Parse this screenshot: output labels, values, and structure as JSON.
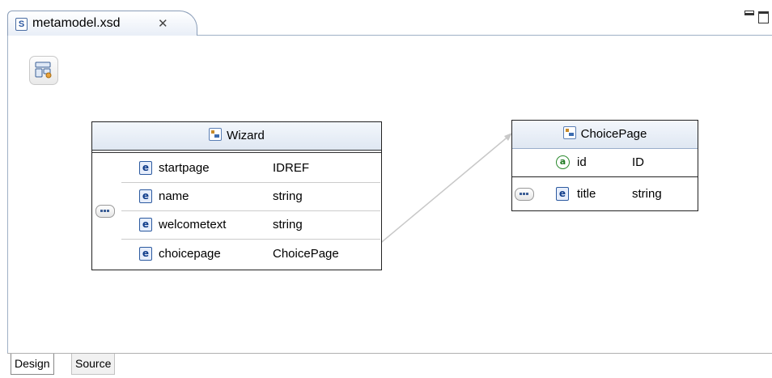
{
  "editor_tab": {
    "icon_letter": "S",
    "title": "metamodel.xsd",
    "close_glyph": "✕"
  },
  "wizard": {
    "name": "Wizard",
    "elements": [
      {
        "name": "startpage",
        "type": "IDREF"
      },
      {
        "name": "name",
        "type": "string"
      },
      {
        "name": "welcometext",
        "type": "string"
      },
      {
        "name": "choicepage",
        "type": "ChoicePage"
      }
    ]
  },
  "choicepage": {
    "name": "ChoicePage",
    "attribute": {
      "name": "id",
      "type": "ID"
    },
    "element": {
      "name": "title",
      "type": "string"
    }
  },
  "icons": {
    "element_letter": "e",
    "attribute_letter": "a"
  },
  "bottom_tabs": {
    "design": "Design",
    "source": "Source"
  }
}
